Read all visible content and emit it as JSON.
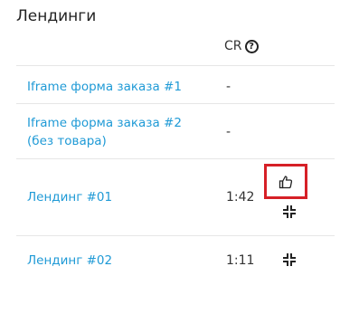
{
  "panel": {
    "title": "Лендинги"
  },
  "table": {
    "header_cr": "CR",
    "header_help": "?",
    "rows": [
      {
        "name": "Iframe форма заказа #1",
        "cr": "-"
      },
      {
        "name": "Iframe форма заказа #2 (без товара)",
        "cr": "-"
      },
      {
        "name": "Лендинг #01",
        "cr": "1:42"
      },
      {
        "name": "Лендинг #02",
        "cr": "1:11"
      }
    ]
  },
  "icons": {
    "like": "thumbs-up-icon",
    "compress": "compress-icon",
    "help": "question-circle-icon"
  },
  "colors": {
    "link": "#1f9ad6",
    "highlight": "#d62027",
    "divider": "#e6e6e6"
  }
}
